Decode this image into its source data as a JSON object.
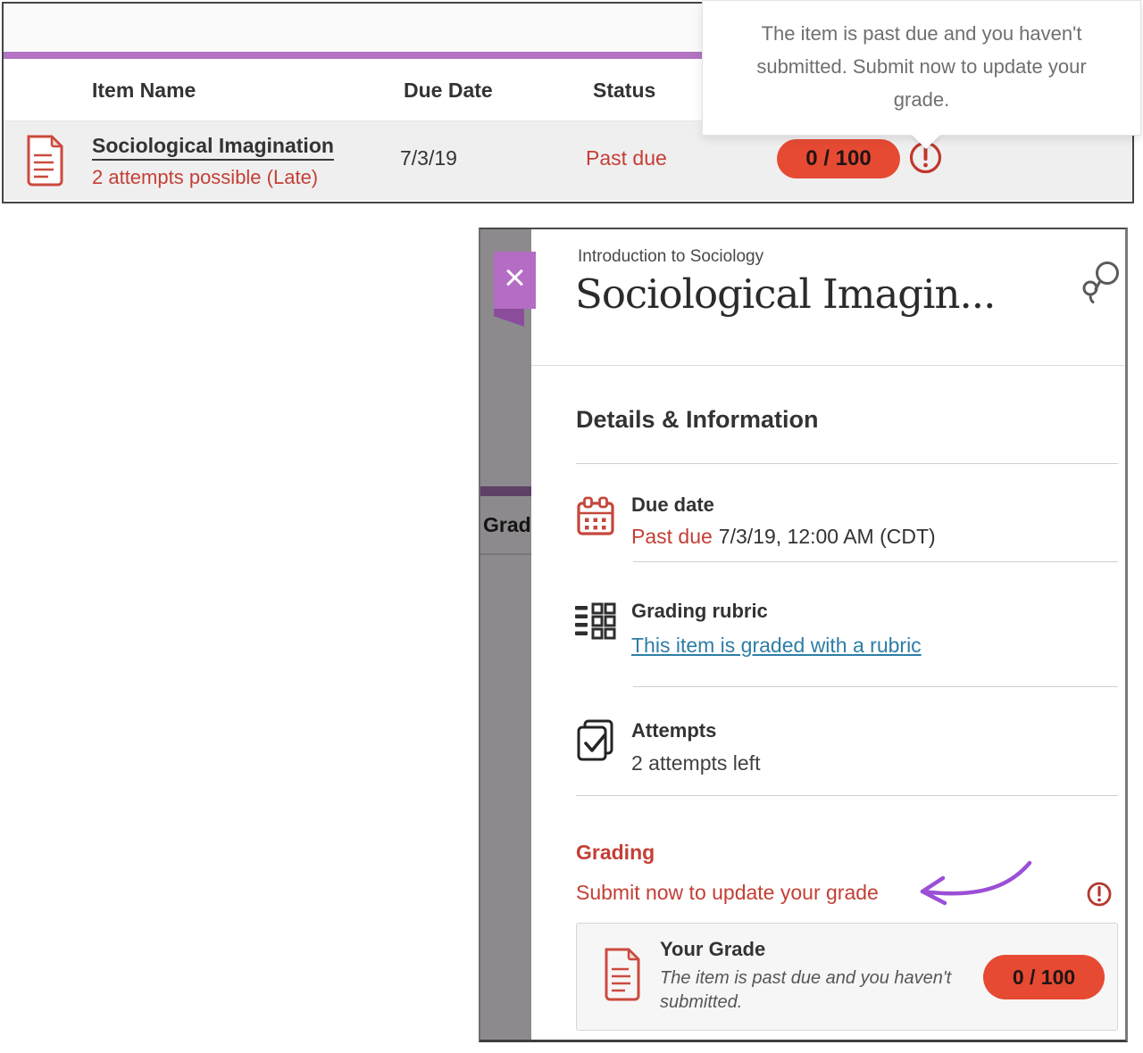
{
  "colors": {
    "accent_purple": "#b273c2",
    "alert_red": "#c33f35",
    "pill_red": "#e64a33",
    "link_blue": "#2e7da6",
    "arrow_purple": "#9b4fd6"
  },
  "grade_table": {
    "columns": [
      "Item Name",
      "Due Date",
      "Status"
    ],
    "row": {
      "name": "Sociological Imagination",
      "attempts_note": "2 attempts possible (Late)",
      "due": "7/3/19",
      "status": "Past due",
      "score": "0 / 100"
    }
  },
  "tooltip": {
    "text": "The item is past due and you haven't submitted. Submit now to update your grade."
  },
  "panel": {
    "course": "Introduction to Sociology",
    "title": "Sociological Imagin...",
    "details_heading": "Details & Information",
    "due": {
      "label": "Due date",
      "status": "Past due",
      "value": "7/3/19, 12:00 AM (CDT)"
    },
    "rubric": {
      "label": "Grading rubric",
      "link": "This item is graded with a rubric"
    },
    "attempts": {
      "label": "Attempts",
      "value": "2 attempts left"
    },
    "grading": {
      "heading": "Grading",
      "message": "Submit now to update your grade"
    },
    "your_grade": {
      "label": "Your Grade",
      "note": "The item is past due and you haven't submitted.",
      "score": "0 / 100"
    }
  },
  "background_page": {
    "grade_column_peek": "Grad"
  },
  "icons": {
    "close": "×"
  }
}
